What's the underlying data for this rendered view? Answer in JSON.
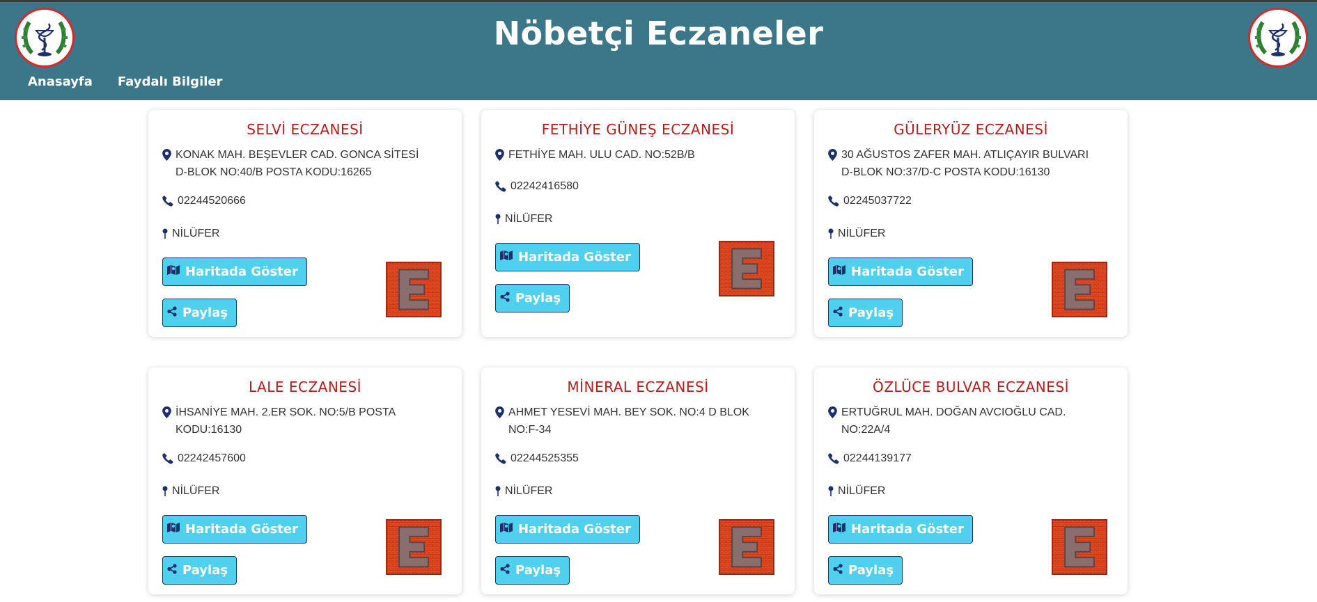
{
  "header": {
    "title": "Nöbetçi Eczaneler",
    "nav": [
      "Anasayfa",
      "Faydalı Bilgiler"
    ]
  },
  "colors": {
    "header_bg": "#3b7689",
    "title_red": "#b81b1b",
    "button_bg": "#4fd0ef",
    "icon_navy": "#1e2f6b"
  },
  "buttons": {
    "map_label": "Haritada Göster",
    "share_label": "Paylaş"
  },
  "pharmacies": [
    {
      "name": "SELVİ ECZANESİ",
      "address": "KONAK MAH. BEŞEVLER CAD. GONCA SİTESİ D-BLOK NO:40/B POSTA KODU:16265",
      "phone": "02244520666",
      "district": "NİLÜFER"
    },
    {
      "name": "FETHİYE GÜNEŞ ECZANESİ",
      "address": "FETHİYE MAH. ULU CAD. NO:52B/B",
      "phone": "02242416580",
      "district": "NİLÜFER"
    },
    {
      "name": "GÜLERYÜZ ECZANESİ",
      "address": "30 AĞUSTOS ZAFER MAH. ATLIÇAYIR BULVARI D-BLOK NO:37/D-C POSTA KODU:16130",
      "phone": "02245037722",
      "district": "NİLÜFER"
    },
    {
      "name": "LALE ECZANESİ",
      "address": "İHSANİYE MAH. 2.ER SOK. NO:5/B POSTA KODU:16130",
      "phone": "02242457600",
      "district": "NİLÜFER"
    },
    {
      "name": "MİNERAL ECZANESİ",
      "address": "AHMET YESEVİ MAH. BEY SOK. NO:4 D BLOK NO:F-34",
      "phone": "02244525355",
      "district": "NİLÜFER"
    },
    {
      "name": "ÖZLÜCE BULVAR ECZANESİ",
      "address": "ERTUĞRUL MAH. DOĞAN AVCIOĞLU CAD. NO:22A/4",
      "phone": "02244139177",
      "district": "NİLÜFER"
    }
  ],
  "icons": [
    "location-pin-icon",
    "phone-icon",
    "district-pin-icon",
    "map-icon",
    "share-icon",
    "pharmacy-e-sign-icon",
    "pharmacy-logo-icon"
  ]
}
